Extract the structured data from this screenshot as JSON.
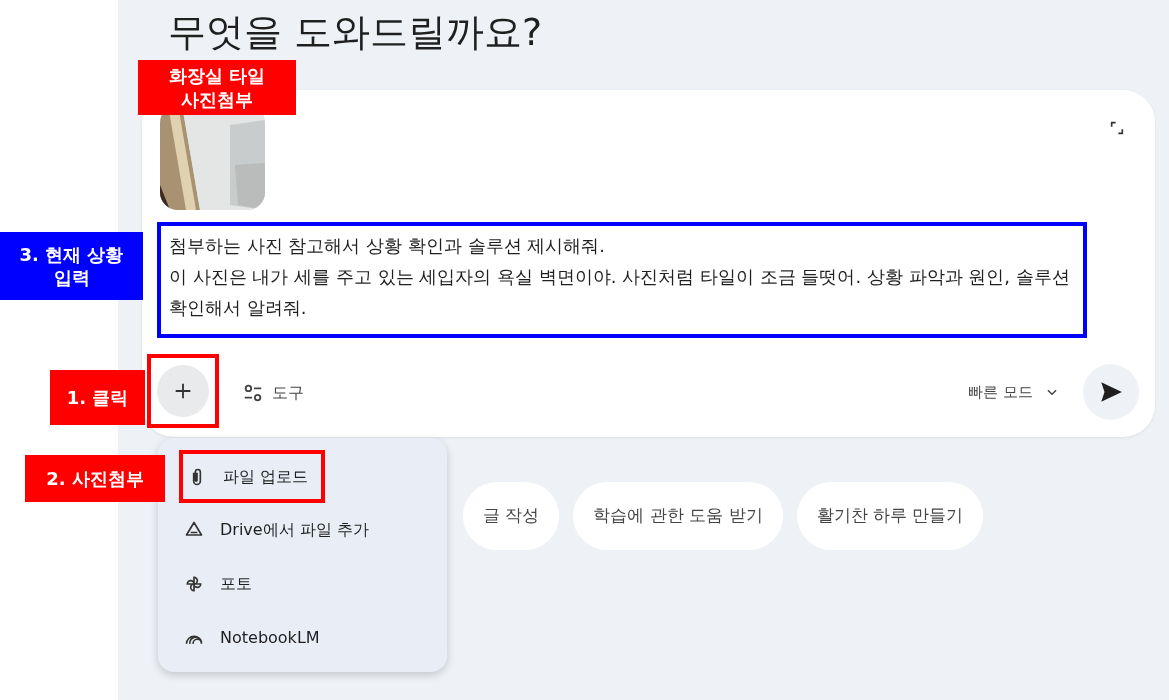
{
  "heading": "무엇을 도와드릴까요?",
  "composer": {
    "attachments": [
      {
        "kind": "picture"
      }
    ],
    "prompt": [
      "첨부하는 사진 참고해서 상황 확인과 솔루션 제시해줘.",
      "이 사진은 내가 세를 주고 있는 세입자의 욕실 벽면이야. 사진처럼 타일이 조금 들떳어. 상황 파악과 원인, 솔루션 확인해서 알려줘."
    ],
    "tools_label": "도구",
    "mode": "빠른 모드"
  },
  "suggestions": [
    "글 작성",
    "학습에 관한 도움 받기",
    "활기찬 하루 만들기"
  ],
  "menu": [
    {
      "kind": "upload",
      "label": "파일 업로드"
    },
    {
      "kind": "drive",
      "label": "Drive에서 파일 추가"
    },
    {
      "kind": "photos",
      "label": "포토"
    },
    {
      "kind": "notebook",
      "label": "NotebookLM"
    }
  ],
  "annotations": [
    {
      "kind": "attachment",
      "color": "#ff0000",
      "lines": [
        "화장실 타일",
        "사진첨부"
      ]
    },
    {
      "kind": "prompt",
      "color": "#0000ff",
      "outline": true,
      "lines": [
        "3. 현재 상황",
        "입력"
      ]
    },
    {
      "kind": "plus",
      "color": "#ff0000",
      "outline": true,
      "lines": [
        "1. 클릭"
      ]
    },
    {
      "kind": "upload",
      "color": "#ff0000",
      "outline": true,
      "lines": [
        "2. 사진첨부"
      ]
    }
  ]
}
